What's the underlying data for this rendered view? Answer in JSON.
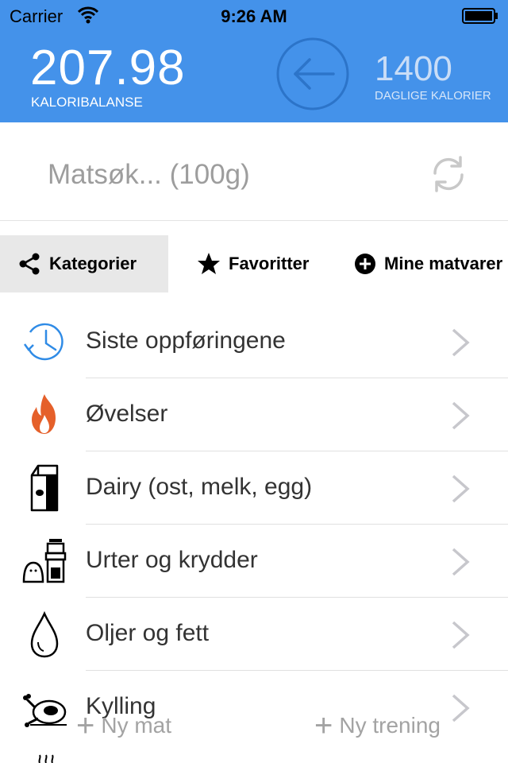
{
  "status": {
    "carrier": "Carrier",
    "time": "9:26 AM"
  },
  "header": {
    "balance_value": "207.98",
    "balance_label": "KALORIBALANSE",
    "daily_value": "1400",
    "daily_label": "DAGLIGE KALORIER",
    "accent": "#4492ea"
  },
  "search": {
    "placeholder": "Matsøk... (100g)"
  },
  "tabs": [
    {
      "label": "Kategorier",
      "icon": "share-icon",
      "active": true
    },
    {
      "label": "Favoritter",
      "icon": "star-icon",
      "active": false
    },
    {
      "label": "Mine matvarer",
      "icon": "plus-circle-icon",
      "active": false
    }
  ],
  "categories": [
    {
      "label": "Siste oppføringene",
      "icon": "history-clock-icon"
    },
    {
      "label": "Øvelser",
      "icon": "flame-icon"
    },
    {
      "label": "Dairy (ost, melk, egg)",
      "icon": "milk-carton-icon"
    },
    {
      "label": "Urter og krydder",
      "icon": "spice-grinder-icon"
    },
    {
      "label": "Oljer og fett",
      "icon": "oil-drop-icon"
    },
    {
      "label": "Kylling",
      "icon": "chicken-icon"
    }
  ],
  "footer": {
    "new_food": "Ny mat",
    "new_workout": "Ny trening"
  }
}
